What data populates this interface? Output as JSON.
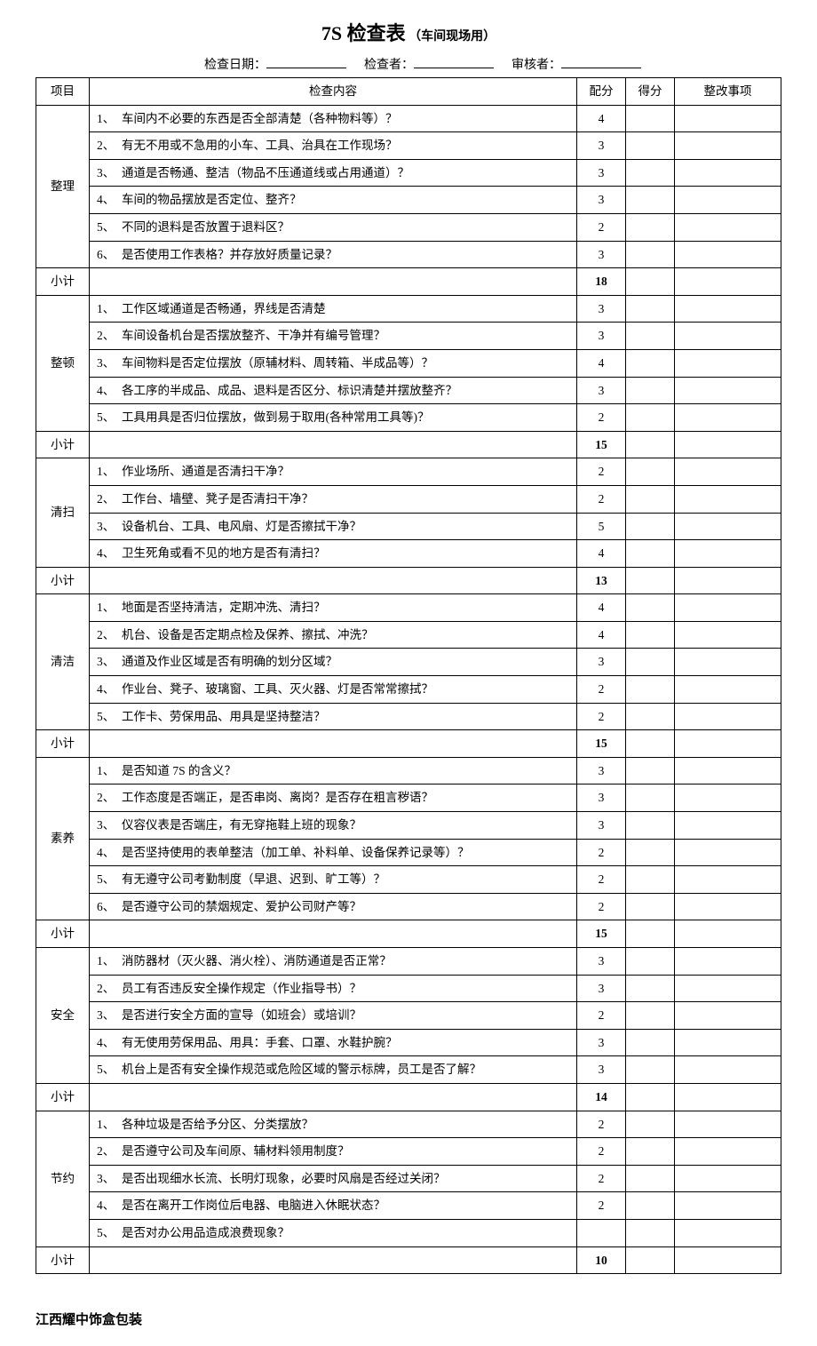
{
  "title": {
    "main": "7S 检查表",
    "sub": "（车间现场用）"
  },
  "meta": {
    "date_label": "检查日期：",
    "inspector_label": "检查者：",
    "reviewer_label": "审核者："
  },
  "headers": {
    "category": "项目",
    "content": "检查内容",
    "allocated": "配分",
    "score": "得分",
    "correction": "整改事项"
  },
  "subtotal_label": "小计",
  "sections": [
    {
      "name": "整理",
      "items": [
        {
          "n": "1、",
          "text": "车间内不必要的东西是否全部清楚（各种物料等）？",
          "pts": "4"
        },
        {
          "n": "2、",
          "text": "有无不用或不急用的小车、工具、治具在工作现场？",
          "pts": "3"
        },
        {
          "n": "3、",
          "text": "通道是否畅通、整洁（物品不压通道线或占用通道）？",
          "pts": "3"
        },
        {
          "n": "4、",
          "text": "车间的物品摆放是否定位、整齐？",
          "pts": "3"
        },
        {
          "n": "5、",
          "text": "不同的退料是否放置于退料区？",
          "pts": "2"
        },
        {
          "n": "6、",
          "text": "是否使用工作表格？并存放好质量记录？",
          "pts": "3"
        }
      ],
      "subtotal": "18"
    },
    {
      "name": "整顿",
      "items": [
        {
          "n": "1、",
          "text": "工作区域通道是否畅通，界线是否清楚",
          "pts": "3"
        },
        {
          "n": "2、",
          "text": "车间设备机台是否摆放整齐、干净并有编号管理？",
          "pts": "3"
        },
        {
          "n": "3、",
          "text": "车间物料是否定位摆放（原辅材料、周转箱、半成品等）？",
          "pts": "4"
        },
        {
          "n": "4、",
          "text": "各工序的半成品、成品、退料是否区分、标识清楚并摆放整齐？",
          "pts": "3"
        },
        {
          "n": "5、",
          "text": "工具用具是否归位摆放，做到易于取用(各种常用工具等)？",
          "pts": "2"
        }
      ],
      "subtotal": "15"
    },
    {
      "name": "清扫",
      "items": [
        {
          "n": "1、",
          "text": "作业场所、通道是否清扫干净？",
          "pts": "2"
        },
        {
          "n": "2、",
          "text": "工作台、墙壁、凳子是否清扫干净？",
          "pts": "2"
        },
        {
          "n": "3、",
          "text": "设备机台、工具、电风扇、灯是否擦拭干净？",
          "pts": "5"
        },
        {
          "n": "4、",
          "text": "卫生死角或看不见的地方是否有清扫？",
          "pts": "4"
        }
      ],
      "subtotal": "13"
    },
    {
      "name": "清洁",
      "items": [
        {
          "n": "1、",
          "text": "地面是否坚持清洁，定期冲洗、清扫？",
          "pts": "4"
        },
        {
          "n": "2、",
          "text": "机台、设备是否定期点检及保养、擦拭、冲洗？",
          "pts": "4"
        },
        {
          "n": "3、",
          "text": "通道及作业区域是否有明确的划分区域？",
          "pts": "3"
        },
        {
          "n": "4、",
          "text": "作业台、凳子、玻璃窗、工具、灭火器、灯是否常常擦拭？",
          "pts": "2"
        },
        {
          "n": "5、",
          "text": "工作卡、劳保用品、用具是坚持整洁？",
          "pts": "2"
        }
      ],
      "subtotal": "15"
    },
    {
      "name": "素养",
      "items": [
        {
          "n": "1、",
          "text": "是否知道 7S 的含义？",
          "pts": "3"
        },
        {
          "n": "2、",
          "text": "工作态度是否端正，是否串岗、离岗？是否存在粗言秽语？",
          "pts": "3"
        },
        {
          "n": "3、",
          "text": "仪容仪表是否端庄，有无穿拖鞋上班的现象？",
          "pts": "3"
        },
        {
          "n": "4、",
          "text": "是否坚持使用的表单整洁（加工单、补料单、设备保养记录等）？",
          "pts": "2"
        },
        {
          "n": "5、",
          "text": "有无遵守公司考勤制度（早退、迟到、旷工等）？",
          "pts": "2"
        },
        {
          "n": "6、",
          "text": "是否遵守公司的禁烟规定、爱护公司财产等？",
          "pts": "2"
        }
      ],
      "subtotal": "15"
    },
    {
      "name": "安全",
      "items": [
        {
          "n": "1、",
          "text": "消防器材（灭火器、消火栓）、消防通道是否正常？",
          "pts": "3"
        },
        {
          "n": "2、",
          "text": "员工有否违反安全操作规定（作业指导书）？",
          "pts": "3"
        },
        {
          "n": "3、",
          "text": "是否进行安全方面的宣导（如班会）或培训？",
          "pts": "2"
        },
        {
          "n": "4、",
          "text": "有无使用劳保用品、用具：手套、口罩、水鞋护腕？",
          "pts": "3"
        },
        {
          "n": "5、",
          "text": "机台上是否有安全操作规范或危险区域的警示标牌，员工是否了解？",
          "pts": "3"
        }
      ],
      "subtotal": "14"
    },
    {
      "name": "节约",
      "items": [
        {
          "n": "1、",
          "text": "各种垃圾是否给予分区、分类摆放？",
          "pts": "2"
        },
        {
          "n": "2、",
          "text": "是否遵守公司及车间原、辅材料领用制度？",
          "pts": "2"
        },
        {
          "n": "3、",
          "text": "是否出现细水长流、长明灯现象，必要时风扇是否经过关闭？",
          "pts": "2"
        },
        {
          "n": "4、",
          "text": "是否在离开工作岗位后电器、电脑进入休眠状态？",
          "pts": "2"
        },
        {
          "n": "5、",
          "text": "是否对办公用品造成浪费现象？",
          "pts": ""
        }
      ],
      "subtotal": "10"
    }
  ],
  "footer": "江西耀中饰盒包装"
}
